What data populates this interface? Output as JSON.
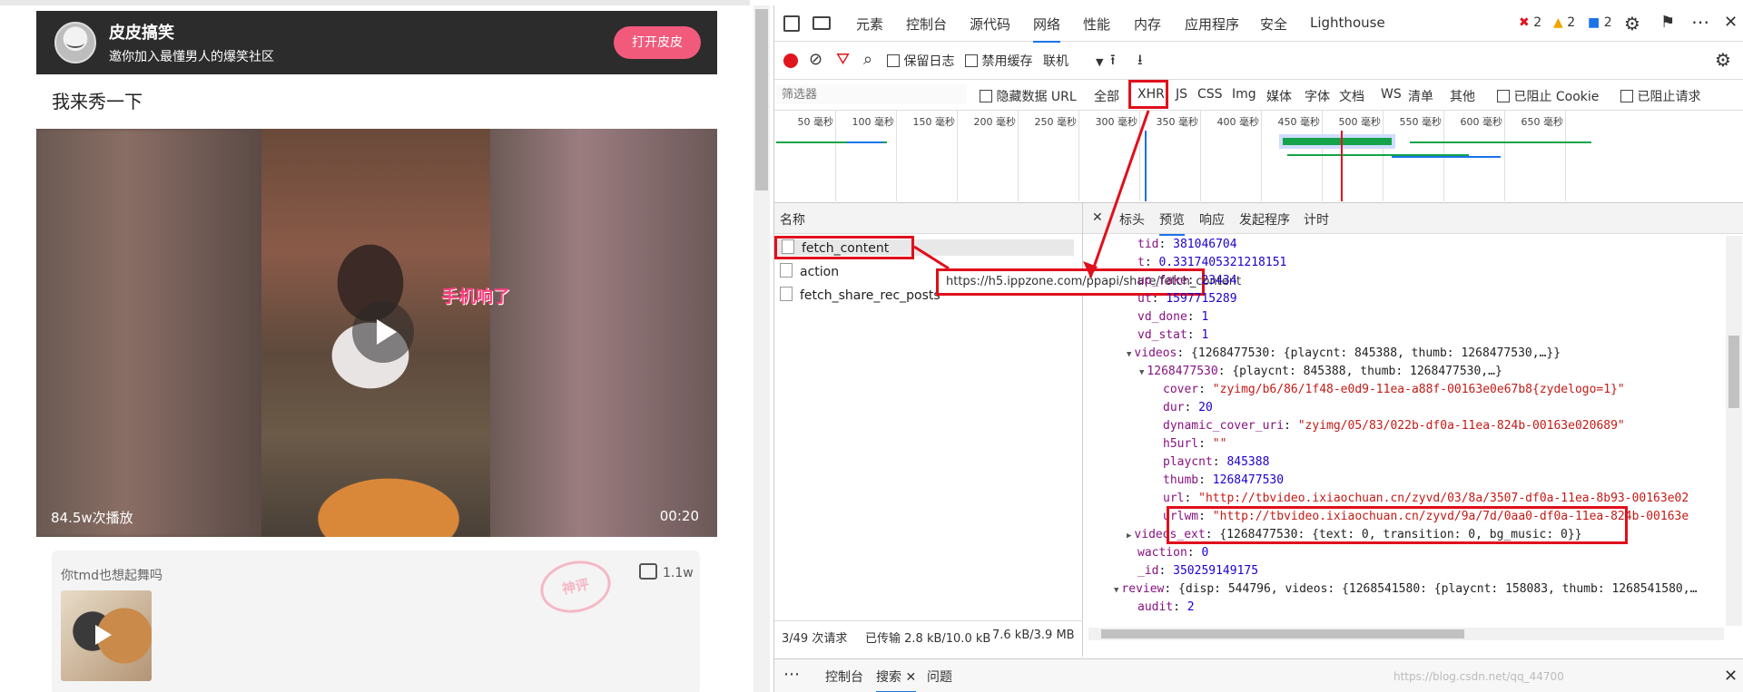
{
  "left_page": {
    "app_name": "皮皮搞笑",
    "app_tagline": "邀你加入最懂男人的爆笑社区",
    "open_button": "打开皮皮",
    "post_title": "我来秀一下",
    "video": {
      "caption": "手机响了",
      "views": "84.5w次播放",
      "duration": "00:20"
    },
    "comment": {
      "text": "你tmd也想起舞吗",
      "likes": "1.1w",
      "stamp": "神评"
    }
  },
  "devtools": {
    "tabs": [
      "元素",
      "控制台",
      "源代码",
      "网络",
      "性能",
      "内存",
      "应用程序",
      "安全",
      "Lighthouse"
    ],
    "active_tab": "网络",
    "badges": {
      "errors": "2",
      "warnings": "2",
      "info": "2"
    },
    "toolbar": {
      "preserve_log": "保留日志",
      "disable_cache": "禁用缓存",
      "throttle": "联机"
    },
    "filter": {
      "placeholder": "筛选器",
      "hide_data_url": "隐藏数据 URL",
      "types": [
        "全部",
        "XHR",
        "JS",
        "CSS",
        "Img",
        "媒体",
        "字体",
        "文档",
        "WS",
        "清单",
        "其他"
      ],
      "blocked_cookies": "已阻止 Cookie",
      "blocked_requests": "已阻止请求"
    },
    "timeline_ticks": [
      "50 毫秒",
      "100 毫秒",
      "150 毫秒",
      "200 毫秒",
      "250 毫秒",
      "300 毫秒",
      "350 毫秒",
      "400 毫秒",
      "450 毫秒",
      "500 毫秒",
      "550 毫秒",
      "600 毫秒",
      "650 毫秒"
    ],
    "requests": {
      "header": "名称",
      "items": [
        "fetch_content",
        "action",
        "fetch_share_rec_posts"
      ],
      "tooltip": "https://h5.ippzone.com/ppapi/share/fetch_content"
    },
    "detail_tabs": [
      "标头",
      "预览",
      "响应",
      "发起程序",
      "计时"
    ],
    "active_detail_tab": "预览",
    "json_lines": [
      {
        "key": "tid",
        "value": "381046704",
        "kind": "n",
        "indent": 0
      },
      {
        "key": "t",
        "value": "0.3317405321218151",
        "kind": "n",
        "indent": 0
      },
      {
        "key": "up_fake",
        "value": "23434",
        "kind": "n",
        "indent": 0
      },
      {
        "key": "ut",
        "value": "1597715289",
        "kind": "n",
        "indent": 0
      },
      {
        "key": "vd_done",
        "value": "1",
        "kind": "n",
        "indent": 0
      },
      {
        "key": "vd_stat",
        "value": "1",
        "kind": "n",
        "indent": 0
      },
      {
        "key": "videos",
        "value": "{1268477530: {playcnt: 845388, thumb: 1268477530,…}}",
        "kind": "p",
        "indent": 0,
        "arrow": "▼"
      },
      {
        "key": "1268477530",
        "value": "{playcnt: 845388, thumb: 1268477530,…}",
        "kind": "p",
        "indent": 1,
        "arrow": "▼"
      },
      {
        "key": "cover",
        "value": "\"zyimg/b6/86/1f48-e0d9-11ea-a88f-00163e0e67b8{zydelogo=1}\"",
        "kind": "s",
        "indent": 2
      },
      {
        "key": "dur",
        "value": "20",
        "kind": "n",
        "indent": 2
      },
      {
        "key": "dynamic_cover_uri",
        "value": "\"zyimg/05/83/022b-df0a-11ea-824b-00163e020689\"",
        "kind": "s",
        "indent": 2
      },
      {
        "key": "h5url",
        "value": "\"\"",
        "kind": "s",
        "indent": 2
      },
      {
        "key": "playcnt",
        "value": "845388",
        "kind": "n",
        "indent": 2
      },
      {
        "key": "thumb",
        "value": "1268477530",
        "kind": "n",
        "indent": 2
      },
      {
        "key": "url",
        "value": "\"http://tbvideo.ixiaochuan.cn/zyvd/03/8a/3507-df0a-11ea-8b93-00163e02",
        "kind": "s",
        "indent": 2
      },
      {
        "key": "urlwm",
        "value": "\"http://tbvideo.ixiaochuan.cn/zyvd/9a/7d/0aa0-df0a-11ea-824b-00163e",
        "kind": "s",
        "indent": 2
      },
      {
        "key": "videos_ext",
        "value": "{1268477530: {text: 0, transition: 0, bg_music: 0}}",
        "kind": "p",
        "indent": 0,
        "arrow": "▶"
      },
      {
        "key": "waction",
        "value": "0",
        "kind": "n",
        "indent": 0
      },
      {
        "key": "_id",
        "value": "350259149175",
        "kind": "n",
        "indent": 0
      },
      {
        "key": "review",
        "value": "{disp: 544796, videos: {1268541580: {playcnt: 158083, thumb: 1268541580,…",
        "kind": "p",
        "indent": -1,
        "arrow": "▼"
      },
      {
        "key": "audit",
        "value": "2",
        "kind": "n",
        "indent": 0
      }
    ],
    "status": {
      "requests": "3/49 次请求",
      "transferred": "已传输 2.8 kB/10.0 kB",
      "resources": "7.6 kB/3.9 MB"
    },
    "drawer_tabs": [
      "控制台",
      "搜索",
      "问题"
    ],
    "active_drawer_tab": "搜索",
    "watermark": "https://blog.csdn.net/qq_44700"
  }
}
